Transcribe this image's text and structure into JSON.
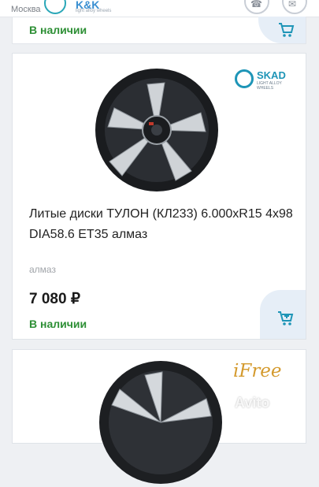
{
  "header": {
    "city": "Москва",
    "brand_logo": "K&K",
    "brand_sub": "light alloy wheels"
  },
  "previous_card": {
    "stock": "В наличии"
  },
  "product": {
    "brand": "SKAD",
    "brand_sub": "LIGHT ALLOY WHEELS",
    "title": "Литые диски ТУЛОН (КЛ233) 6.000xR15 4x98 DIA58.6 ET35 алмаз",
    "subtitle": "алмаз",
    "price": "7 080 ₽",
    "stock": "В наличии"
  },
  "next_card": {
    "brand": "iFree"
  },
  "watermark": "Avito",
  "colors": {
    "stock_green": "#2d8f35",
    "accent_blue": "#1e95b7",
    "cart_bg": "#e6eef7"
  },
  "icons": {
    "cart": "cart-icon",
    "phone": "phone-icon",
    "chat": "chat-icon"
  }
}
